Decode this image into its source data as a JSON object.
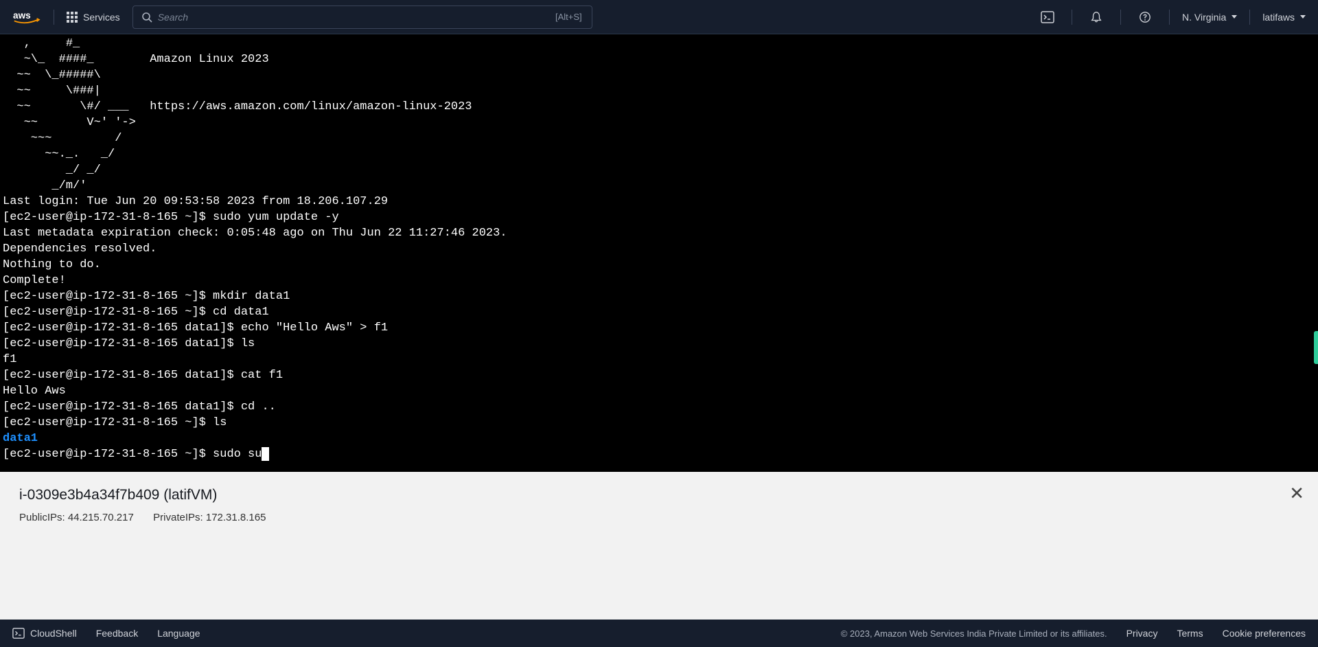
{
  "nav": {
    "services_label": "Services",
    "search_placeholder": "Search",
    "search_hint": "[Alt+S]",
    "region": "N. Virginia",
    "account": "latifaws"
  },
  "terminal": {
    "motd": "   ,     #_\n   ~\\_  ####_        Amazon Linux 2023\n  ~~  \\_#####\\\n  ~~     \\###|\n  ~~       \\#/ ___   https://aws.amazon.com/linux/amazon-linux-2023\n   ~~       V~' '->\n    ~~~         /\n      ~~._.   _/\n         _/ _/\n       _/m/'",
    "last_login": "Last login: Tue Jun 20 09:53:58 2023 from 18.206.107.29",
    "lines": [
      "[ec2-user@ip-172-31-8-165 ~]$ sudo yum update -y",
      "Last metadata expiration check: 0:05:48 ago on Thu Jun 22 11:27:46 2023.",
      "Dependencies resolved.",
      "Nothing to do.",
      "Complete!",
      "[ec2-user@ip-172-31-8-165 ~]$ mkdir data1",
      "[ec2-user@ip-172-31-8-165 ~]$ cd data1",
      "[ec2-user@ip-172-31-8-165 data1]$ echo \"Hello Aws\" > f1",
      "[ec2-user@ip-172-31-8-165 data1]$ ls",
      "f1",
      "[ec2-user@ip-172-31-8-165 data1]$ cat f1",
      "Hello Aws",
      "[ec2-user@ip-172-31-8-165 data1]$ cd ..",
      "[ec2-user@ip-172-31-8-165 ~]$ ls"
    ],
    "dir_output": "data1",
    "current_prompt": "[ec2-user@ip-172-31-8-165 ~]$ sudo su"
  },
  "info": {
    "title": "i-0309e3b4a34f7b409 (latifVM)",
    "public_label": "PublicIPs:",
    "public_value": "44.215.70.217",
    "private_label": "PrivateIPs:",
    "private_value": "172.31.8.165"
  },
  "footer": {
    "cloudshell": "CloudShell",
    "feedback": "Feedback",
    "language": "Language",
    "copyright": "© 2023, Amazon Web Services India Private Limited or its affiliates.",
    "privacy": "Privacy",
    "terms": "Terms",
    "cookies": "Cookie preferences"
  }
}
